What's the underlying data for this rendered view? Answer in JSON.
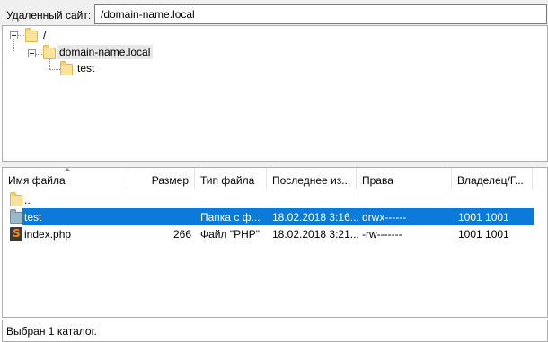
{
  "remote_site": {
    "label": "Удаленный сайт:",
    "path": "/domain-name.local"
  },
  "tree": {
    "root": "/",
    "site": "domain-name.local",
    "child": "test"
  },
  "list": {
    "columns": [
      "Имя файла",
      "Размер",
      "Тип файла",
      "Последнее из...",
      "Права",
      "Владелец/Г..."
    ],
    "rows": [
      {
        "name": "..",
        "size": "",
        "type": "",
        "modified": "",
        "perms": "",
        "owner": "",
        "icon": "folder-icon",
        "selected": false
      },
      {
        "name": "test",
        "size": "",
        "type": "Папка с ф...",
        "modified": "18.02.2018 3:16...",
        "perms": "drwx------",
        "owner": "1001 1001",
        "icon": "folder-icon",
        "selected": true
      },
      {
        "name": "index.php",
        "size": "266",
        "type": "Файл \"PHP\"",
        "modified": "18.02.2018 3:21...",
        "perms": "-rw-------",
        "owner": "1001 1001",
        "icon": "php-file-icon",
        "selected": false
      }
    ]
  },
  "status": {
    "text": "Выбран 1 каталог."
  },
  "colors": {
    "selection": "#0b7ad8",
    "folder": "#fbe29b"
  }
}
